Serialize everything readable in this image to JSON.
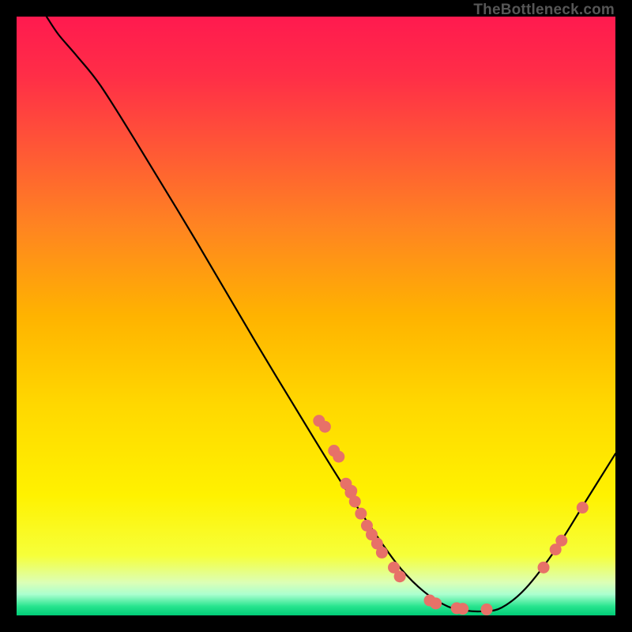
{
  "attribution": "TheBottleneck.com",
  "chart_data": {
    "type": "line",
    "title": "",
    "xlabel": "",
    "ylabel": "",
    "xlim": [
      0,
      100
    ],
    "ylim": [
      0,
      100
    ],
    "background_gradient": {
      "stops": [
        {
          "offset": 0.0,
          "color": "#ff1a4f"
        },
        {
          "offset": 0.1,
          "color": "#ff2e47"
        },
        {
          "offset": 0.22,
          "color": "#ff5736"
        },
        {
          "offset": 0.35,
          "color": "#ff8421"
        },
        {
          "offset": 0.5,
          "color": "#ffb300"
        },
        {
          "offset": 0.65,
          "color": "#ffd800"
        },
        {
          "offset": 0.8,
          "color": "#fff200"
        },
        {
          "offset": 0.9,
          "color": "#f6ff3a"
        },
        {
          "offset": 0.945,
          "color": "#dcffb6"
        },
        {
          "offset": 0.965,
          "color": "#aaffcf"
        },
        {
          "offset": 0.985,
          "color": "#27e48e"
        },
        {
          "offset": 1.0,
          "color": "#00cc77"
        }
      ]
    },
    "curve": [
      {
        "x": 5.0,
        "y": 100.0
      },
      {
        "x": 7.0,
        "y": 97.0
      },
      {
        "x": 10.0,
        "y": 93.5
      },
      {
        "x": 14.0,
        "y": 88.5
      },
      {
        "x": 20.0,
        "y": 79.0
      },
      {
        "x": 30.0,
        "y": 62.5
      },
      {
        "x": 40.0,
        "y": 45.5
      },
      {
        "x": 50.0,
        "y": 29.0
      },
      {
        "x": 55.0,
        "y": 21.0
      },
      {
        "x": 60.0,
        "y": 13.5
      },
      {
        "x": 64.0,
        "y": 8.0
      },
      {
        "x": 68.0,
        "y": 4.0
      },
      {
        "x": 72.0,
        "y": 1.5
      },
      {
        "x": 75.0,
        "y": 0.8
      },
      {
        "x": 78.0,
        "y": 0.7
      },
      {
        "x": 81.0,
        "y": 1.3
      },
      {
        "x": 85.0,
        "y": 4.5
      },
      {
        "x": 90.0,
        "y": 11.0
      },
      {
        "x": 95.0,
        "y": 19.0
      },
      {
        "x": 100.0,
        "y": 27.0
      }
    ],
    "curve_color": "#000000",
    "curve_width": 2.2,
    "scatter": [
      {
        "x": 50.5,
        "y": 32.5
      },
      {
        "x": 51.5,
        "y": 31.5
      },
      {
        "x": 53.0,
        "y": 27.5
      },
      {
        "x": 53.8,
        "y": 26.5
      },
      {
        "x": 55.0,
        "y": 22.0
      },
      {
        "x": 55.8,
        "y": 20.5
      },
      {
        "x": 55.9,
        "y": 20.8
      },
      {
        "x": 56.5,
        "y": 19.0
      },
      {
        "x": 57.5,
        "y": 17.0
      },
      {
        "x": 58.5,
        "y": 15.0
      },
      {
        "x": 59.3,
        "y": 13.5
      },
      {
        "x": 60.2,
        "y": 12.0
      },
      {
        "x": 61.0,
        "y": 10.5
      },
      {
        "x": 63.0,
        "y": 8.0
      },
      {
        "x": 64.0,
        "y": 6.5
      },
      {
        "x": 69.0,
        "y": 2.5
      },
      {
        "x": 70.0,
        "y": 2.0
      },
      {
        "x": 73.5,
        "y": 1.2
      },
      {
        "x": 74.5,
        "y": 1.1
      },
      {
        "x": 78.5,
        "y": 1.0
      },
      {
        "x": 88.0,
        "y": 8.0
      },
      {
        "x": 90.0,
        "y": 11.0
      },
      {
        "x": 91.0,
        "y": 12.5
      },
      {
        "x": 94.5,
        "y": 18.0
      }
    ],
    "scatter_color": "#e77168",
    "scatter_radius": 7.5
  }
}
